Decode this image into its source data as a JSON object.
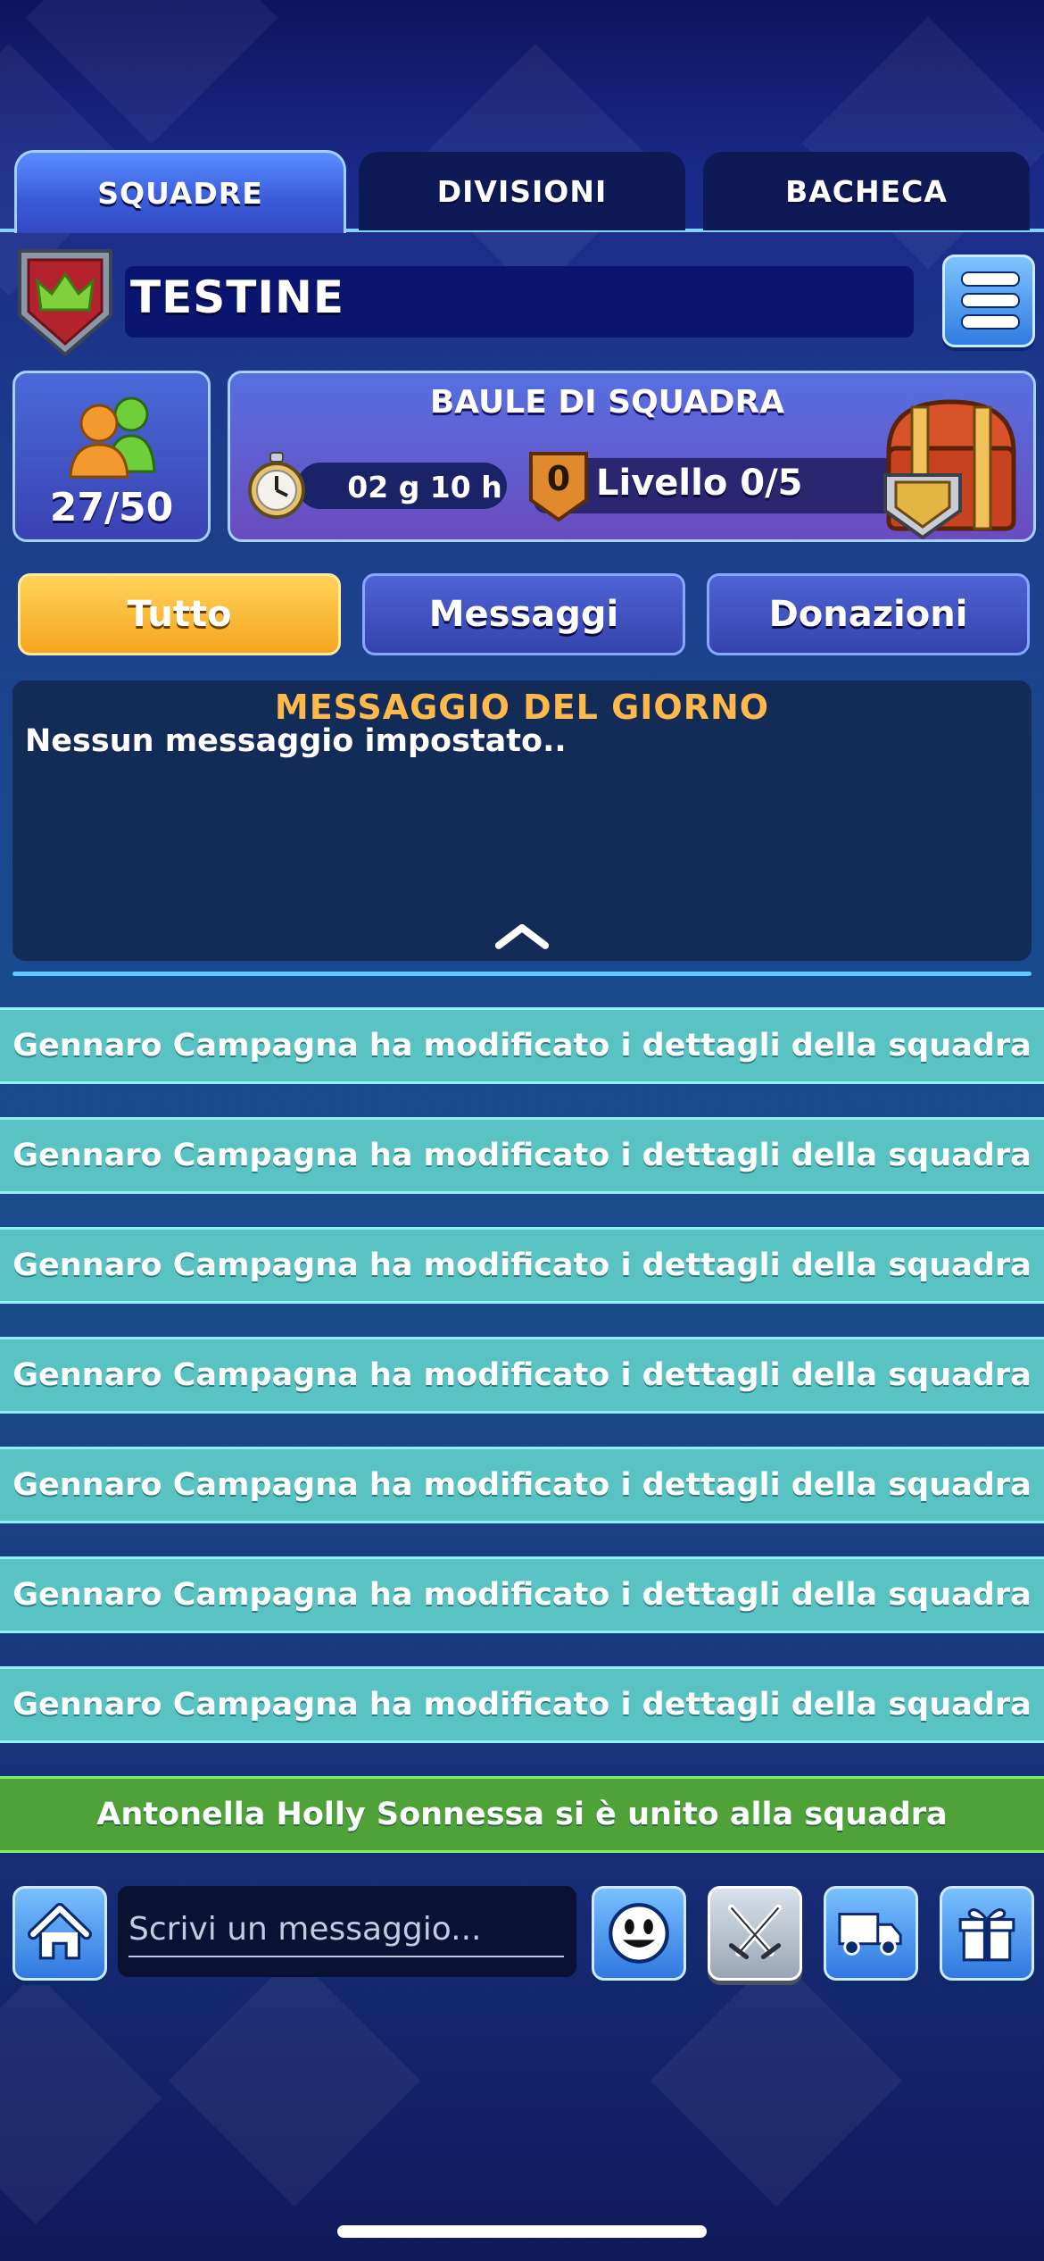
{
  "top_tabs": [
    {
      "label": "SQUADRE",
      "active": true
    },
    {
      "label": "DIVISIONI",
      "active": false
    },
    {
      "label": "BACHECA",
      "active": false
    }
  ],
  "team": {
    "name": "TESTINE",
    "members": "27/50",
    "icons": {
      "shield": "team-shield-crown-icon",
      "members": "members-icon",
      "menu": "menu-icon"
    }
  },
  "chest": {
    "title": "BAULE DI SQUADRA",
    "timer": "02 g 10 h",
    "level_badge": "0",
    "level_text": "Livello 0/5",
    "icons": {
      "timer": "stopwatch-icon",
      "chest": "treasure-chest-icon"
    }
  },
  "filters": [
    {
      "label": "Tutto",
      "active": true
    },
    {
      "label": "Messaggi",
      "active": false
    },
    {
      "label": "Donazioni",
      "active": false
    }
  ],
  "motd": {
    "title": "MESSAGGIO DEL GIORNO",
    "text": "Nessun messaggio impostato.."
  },
  "feed": [
    {
      "text": "Gennaro Campagna ha modificato i dettagli della squadra",
      "type": "event"
    },
    {
      "text": "Gennaro Campagna ha modificato i dettagli della squadra",
      "type": "event"
    },
    {
      "text": "Gennaro Campagna ha modificato i dettagli della squadra",
      "type": "event"
    },
    {
      "text": "Gennaro Campagna ha modificato i dettagli della squadra",
      "type": "event"
    },
    {
      "text": "Gennaro Campagna ha modificato i dettagli della squadra",
      "type": "event"
    },
    {
      "text": "Gennaro Campagna ha modificato i dettagli della squadra",
      "type": "event"
    },
    {
      "text": "Gennaro Campagna ha modificato i dettagli della squadra",
      "type": "event"
    },
    {
      "text": "Antonella Holly Sonnessa si è unito alla squadra",
      "type": "join"
    }
  ],
  "chat": {
    "placeholder": "Scrivi un messaggio..."
  },
  "bottom_icons": [
    "home-icon",
    "smiley-icon",
    "crossed-swords-icon",
    "delivery-truck-icon",
    "gift-icon"
  ],
  "colors": {
    "active_tab": "#3a5bd9",
    "filter_active": "#f5a51f",
    "motd_title": "#ffb84a",
    "feed_event": "#58c3c2",
    "feed_join": "#4fa238"
  }
}
